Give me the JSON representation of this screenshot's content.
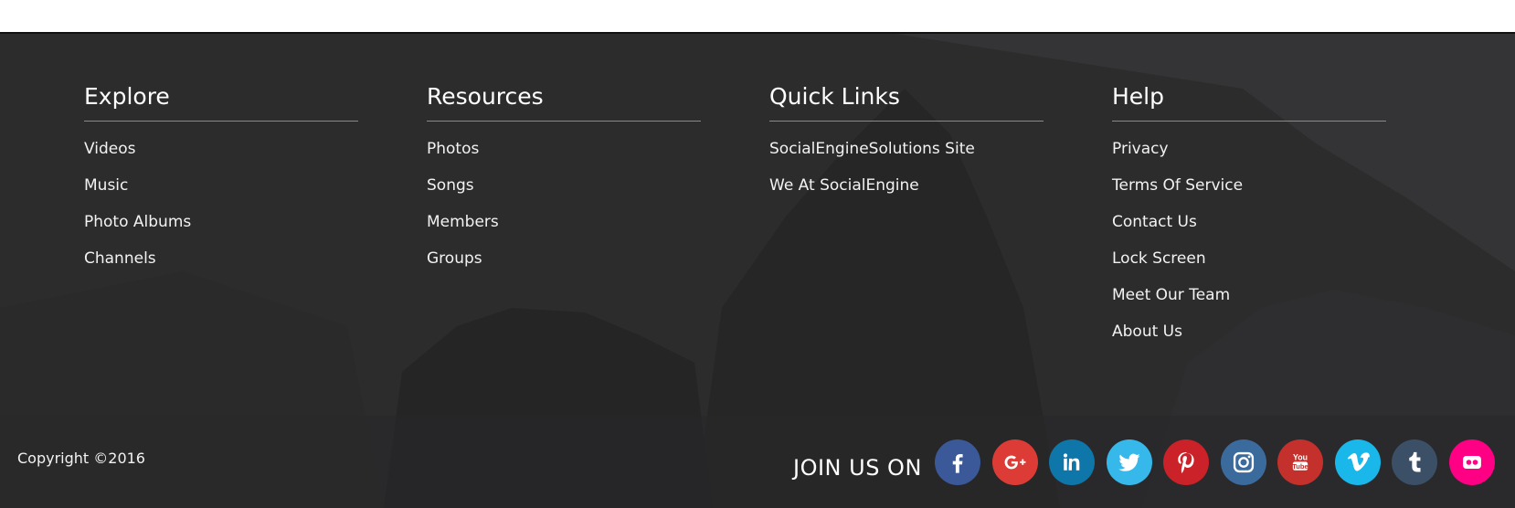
{
  "columns": [
    {
      "title": "Explore",
      "links": [
        "Videos",
        "Music",
        "Photo Albums",
        "Channels"
      ]
    },
    {
      "title": "Resources",
      "links": [
        "Photos",
        "Songs",
        "Members",
        "Groups"
      ]
    },
    {
      "title": "Quick Links",
      "links": [
        "SocialEngineSolutions Site",
        "We At SocialEngine"
      ]
    },
    {
      "title": "Help",
      "links": [
        "Privacy",
        "Terms Of Service",
        "Contact Us",
        "Lock Screen",
        "Meet Our Team",
        "About Us"
      ]
    }
  ],
  "bottom": {
    "copyright": "Copyright ©2016",
    "join_label": "JOIN US ON"
  },
  "social": [
    {
      "icon": "facebook-icon",
      "color": "#3b5998"
    },
    {
      "icon": "google-plus-icon",
      "color": "#dd3c36"
    },
    {
      "icon": "linkedin-icon",
      "color": "#0e76a8"
    },
    {
      "icon": "twitter-icon",
      "color": "#37b8ea"
    },
    {
      "icon": "pinterest-icon",
      "color": "#cb2128"
    },
    {
      "icon": "instagram-icon",
      "color": "#3b6b9d"
    },
    {
      "icon": "youtube-icon",
      "color": "#c4302b"
    },
    {
      "icon": "vimeo-icon",
      "color": "#1ab7ea"
    },
    {
      "icon": "tumblr-icon",
      "color": "#3b4f66"
    },
    {
      "icon": "flickr-icon",
      "color": "#ff0084"
    }
  ]
}
